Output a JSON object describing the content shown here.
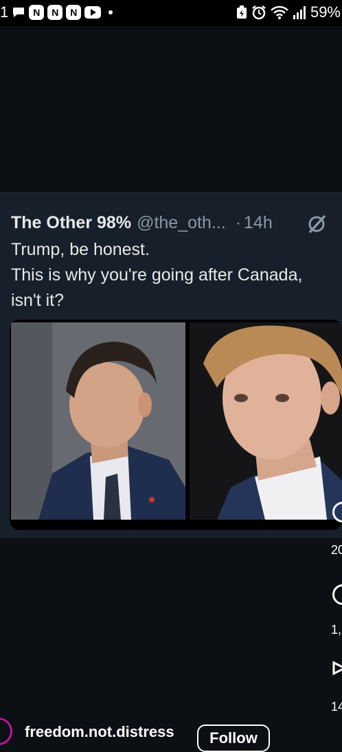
{
  "status_bar": {
    "time": "1",
    "app_icons": [
      "N",
      "N",
      "N"
    ],
    "battery": "59%"
  },
  "tweet": {
    "author": "The Other 98%",
    "handle": "@the_oth...",
    "separator": "·",
    "age": "14h",
    "text_lines": [
      "Trump, be honest.",
      "This is why you're going after Canada,",
      "isn't it?"
    ]
  },
  "rail": {
    "counts": [
      "20",
      "1,",
      "14"
    ]
  },
  "account": {
    "name": "freedom.not.distress",
    "follow_label": "Follow"
  },
  "colors": {
    "background": "#0c0f14",
    "tweet_card": "#17202a",
    "muted_text": "#8b98a5",
    "avatar_ring": "#c1139e"
  }
}
